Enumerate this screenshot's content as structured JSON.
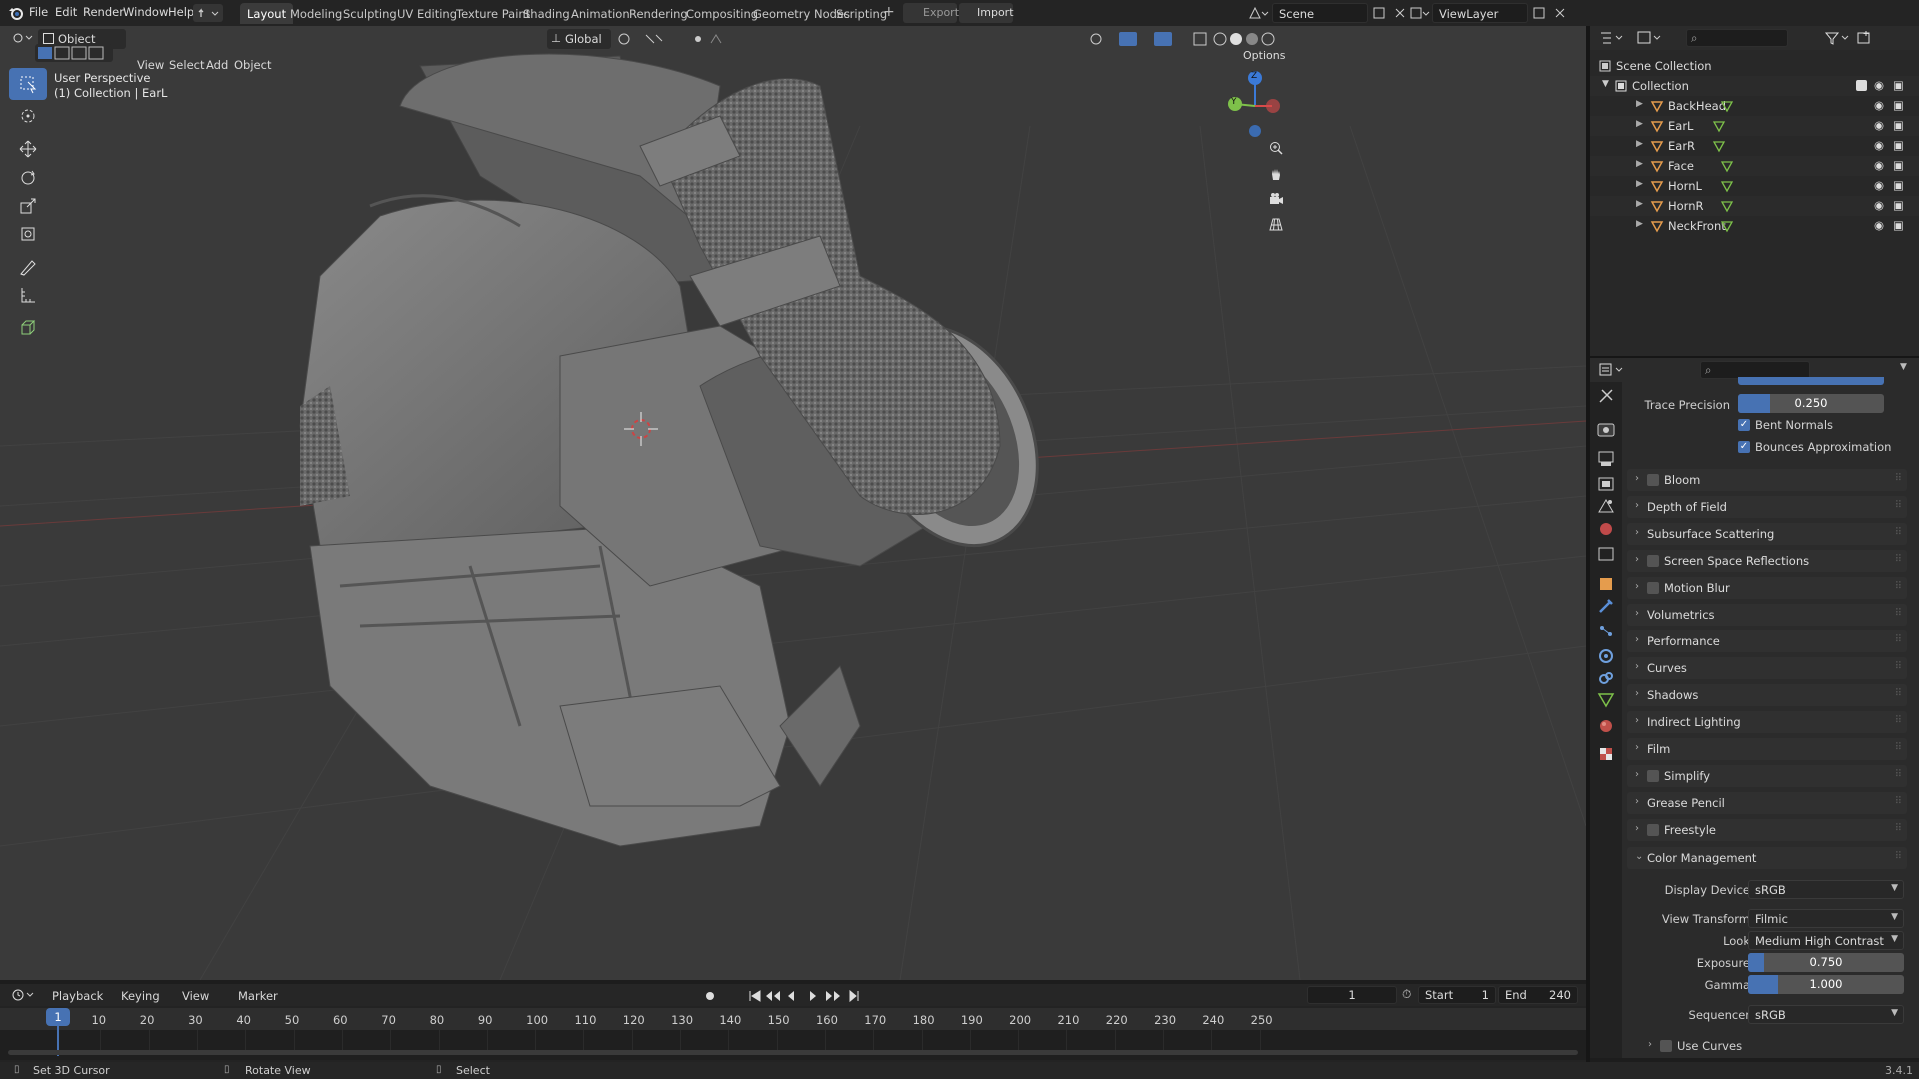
{
  "menu": [
    "File",
    "Edit",
    "Render",
    "Window",
    "Help"
  ],
  "workspaces": [
    "Layout",
    "Modeling",
    "Sculpting",
    "UV Editing",
    "Texture Paint",
    "Shading",
    "Animation",
    "Rendering",
    "Compositing",
    "Geometry Nodes",
    "Scripting"
  ],
  "active_workspace": "Layout",
  "top_buttons": {
    "export": "Export",
    "import": "Import"
  },
  "scene": {
    "name": "Scene",
    "view_layer": "ViewLayer"
  },
  "viewport_header": {
    "mode": "Object Mode",
    "menus": [
      "View",
      "Select",
      "Add",
      "Object"
    ],
    "orientation": "Global",
    "options": "Options"
  },
  "viewport_overlay": {
    "perspective": "User Perspective",
    "collection": "(1) Collection | EarL"
  },
  "gizmo": {
    "x": "X",
    "y": "Y",
    "z": "Z"
  },
  "outliner": {
    "root": "Scene Collection",
    "collection": "Collection",
    "objects": [
      "BackHead",
      "EarL",
      "EarR",
      "Face",
      "HornL",
      "HornR",
      "NeckFront"
    ]
  },
  "properties": {
    "trace_precision_label": "Trace Precision",
    "trace_precision_value": "0.250",
    "trace_precision_fraction": 0.22,
    "bent_normals": "Bent Normals",
    "bounces_approx": "Bounces Approximation",
    "panels": [
      {
        "label": "Bloom",
        "checkbox": true
      },
      {
        "label": "Depth of Field",
        "checkbox": false
      },
      {
        "label": "Subsurface Scattering",
        "checkbox": false
      },
      {
        "label": "Screen Space Reflections",
        "checkbox": true
      },
      {
        "label": "Motion Blur",
        "checkbox": true
      },
      {
        "label": "Volumetrics",
        "checkbox": false
      },
      {
        "label": "Performance",
        "checkbox": false
      },
      {
        "label": "Curves",
        "checkbox": false
      },
      {
        "label": "Shadows",
        "checkbox": false
      },
      {
        "label": "Indirect Lighting",
        "checkbox": false
      },
      {
        "label": "Film",
        "checkbox": false
      },
      {
        "label": "Simplify",
        "checkbox": true
      },
      {
        "label": "Grease Pencil",
        "checkbox": false
      },
      {
        "label": "Freestyle",
        "checkbox": true
      }
    ],
    "color_management": {
      "title": "Color Management",
      "display_device_label": "Display Device",
      "display_device": "sRGB",
      "view_transform_label": "View Transform",
      "view_transform": "Filmic",
      "look_label": "Look",
      "look": "Medium High Contrast",
      "exposure_label": "Exposure",
      "exposure": "0.750",
      "exposure_fraction": 0.1,
      "gamma_label": "Gamma",
      "gamma": "1.000",
      "gamma_fraction": 0.19,
      "sequencer_label": "Sequencer",
      "sequencer": "sRGB",
      "use_curves": "Use Curves"
    }
  },
  "timeline": {
    "menus": [
      "Playback",
      "Keying",
      "View",
      "Marker"
    ],
    "current_frame": "1",
    "start_label": "Start",
    "start": "1",
    "end_label": "End",
    "end": "240",
    "ticks": [
      "1",
      "10",
      "20",
      "30",
      "40",
      "50",
      "60",
      "70",
      "80",
      "90",
      "100",
      "110",
      "120",
      "130",
      "140",
      "150",
      "160",
      "170",
      "180",
      "190",
      "200",
      "210",
      "220",
      "230",
      "240",
      "250"
    ]
  },
  "status": {
    "left": "Set 3D Cursor",
    "middle": "Rotate View",
    "right": "Select",
    "version": "3.4.1"
  },
  "colors": {
    "accent": "#4772b3",
    "orange": "#e59c4d",
    "green": "#7ec14a"
  }
}
